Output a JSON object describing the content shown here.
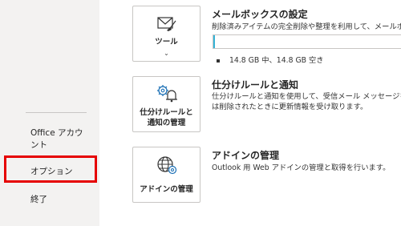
{
  "sidebar": {
    "items": [
      {
        "label": "Office アカウント"
      },
      {
        "label": "オプション"
      },
      {
        "label": "終了"
      }
    ]
  },
  "sections": [
    {
      "button_label": "ツール",
      "icon": "mail-broom-icon",
      "title": "メールボックスの設定",
      "description": "削除済みアイテムの完全削除や整理を利用して、メールボ",
      "storage_text": "14.8 GB 中、14.8 GB 空き",
      "storage_used_fraction": 0.01
    },
    {
      "button_label_line1": "仕分けルールと",
      "button_label_line2": "通知の管理",
      "icon": "gear-bell-icon",
      "title": "仕分けルールと通知",
      "description_line1": "仕分けルールと通知を使用して、受信メール メッセージを",
      "description_line2": "は削除されたときに更新情報を受け取ります。"
    },
    {
      "button_label": "アドインの管理",
      "icon": "globe-gear-icon",
      "title": "アドインの管理",
      "description": "Outlook 用 Web アドインの管理と取得を行います。"
    }
  ],
  "colors": {
    "highlight": "#e60000",
    "progress": "#36b3d6",
    "sidebar_bg": "#f3f2f1"
  }
}
